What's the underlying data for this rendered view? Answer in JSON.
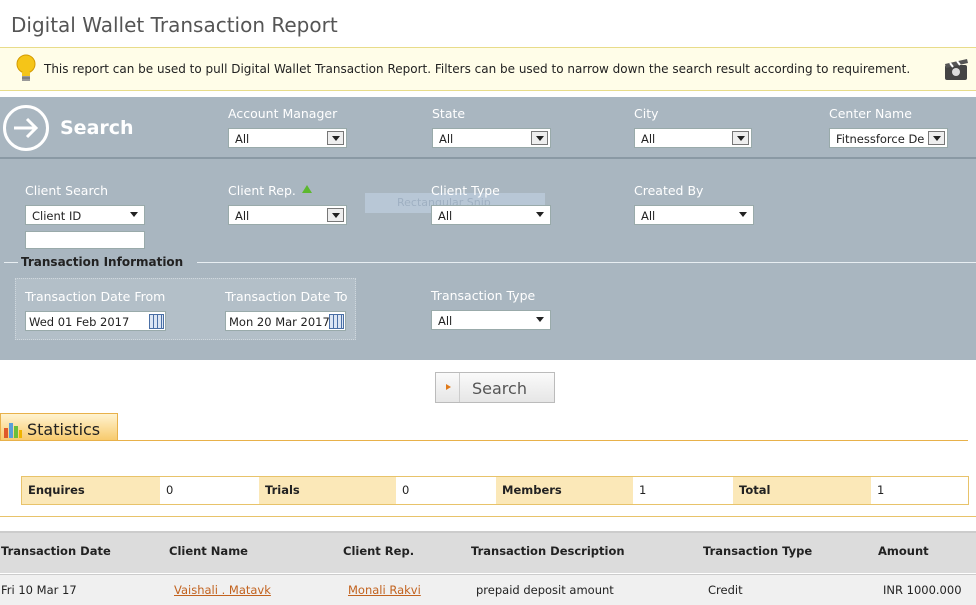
{
  "page": {
    "title": "Digital Wallet Transaction Report"
  },
  "info": {
    "text": "This report can be used to pull Digital Wallet Transaction Report. Filters can be used to narrow down the search result according to requirement."
  },
  "search_panel": {
    "heading": "Search",
    "account_manager": {
      "label": "Account Manager",
      "value": "All"
    },
    "state": {
      "label": "State",
      "value": "All"
    },
    "city": {
      "label": "City",
      "value": "All"
    },
    "center_name": {
      "label": "Center Name",
      "value": "Fitnessforce De"
    },
    "client_search": {
      "label": "Client Search",
      "value": "Client ID",
      "input_value": ""
    },
    "client_rep": {
      "label": "Client Rep.",
      "value": "All"
    },
    "client_type": {
      "label": "Client Type",
      "value": "All"
    },
    "created_by": {
      "label": "Created By",
      "value": "All"
    },
    "snip_overlay": "Rectangular Snip",
    "transaction_info": {
      "legend": "Transaction Information",
      "date_from": {
        "label": "Transaction Date From",
        "value": "Wed 01 Feb 2017"
      },
      "date_to": {
        "label": "Transaction Date To",
        "value": "Mon 20 Mar 2017"
      },
      "type": {
        "label": "Transaction Type",
        "value": "All"
      }
    },
    "search_button": "Search"
  },
  "statistics": {
    "tab_label": "Statistics",
    "items": [
      {
        "label": "Enquires",
        "value": "0"
      },
      {
        "label": "Trials",
        "value": "0"
      },
      {
        "label": "Members",
        "value": "1"
      },
      {
        "label": "Total",
        "value": "1"
      }
    ]
  },
  "grid": {
    "columns": [
      "Transaction Date",
      "Client Name",
      "Client Rep.",
      "Transaction Description",
      "Transaction Type",
      "Amount"
    ],
    "rows": [
      {
        "date": "Fri 10 Mar 17",
        "client_name": "Vaishali . Matavk",
        "client_rep": "Monali Rakvi",
        "description": "prepaid deposit amount",
        "type": "Credit",
        "amount": "INR 1000.000"
      }
    ]
  },
  "colors": {
    "panel": "#a9b6c0",
    "accent": "#f7c96a",
    "link": "#c2621e"
  }
}
